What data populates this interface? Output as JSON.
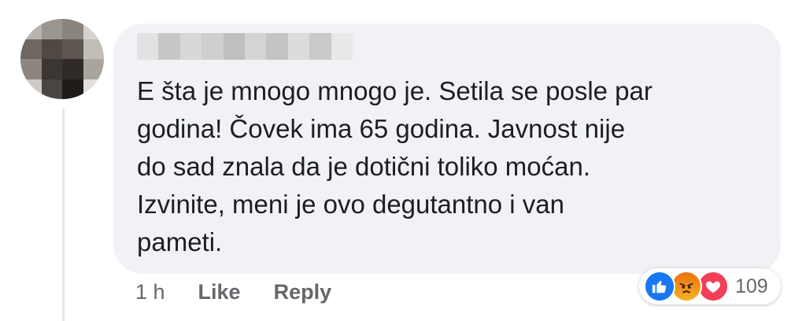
{
  "comment": {
    "text_lines": [
      "E šta je mnogo mnogo je. Setila se posle par",
      "godina! Čovek ima 65 godina. Javnost nije",
      "do sad znala da je dotični toliko moćan.",
      "Izvinite, meni je ovo degutantno i van",
      "pameti."
    ]
  },
  "footer": {
    "time": "1 h",
    "like_label": "Like",
    "reply_label": "Reply"
  },
  "reactions": {
    "types": [
      "like-icon",
      "angry-icon",
      "love-icon"
    ],
    "count": "109"
  },
  "colors": {
    "bubble": "#f0f2f5",
    "text": "#1c1e21",
    "meta": "#65676b",
    "like": "#1877f2",
    "love": "#f33e58",
    "angry": "#e9710f"
  }
}
